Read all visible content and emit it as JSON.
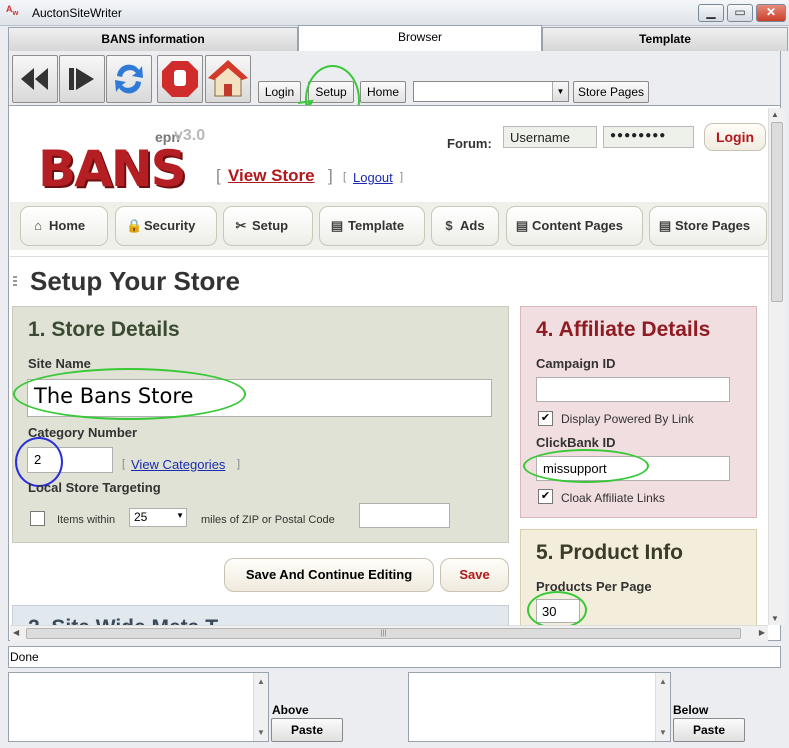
{
  "window": {
    "title": "AuctonSiteWriter",
    "minimize": "▁",
    "maximize": "▭",
    "close": "✕"
  },
  "tabs": [
    "BANS information",
    "Browser",
    "Template"
  ],
  "toolbar": {
    "login": "Login",
    "setup": "Setup",
    "home": "Home",
    "address_value": "",
    "store_pages": "Store Pages"
  },
  "site": {
    "logo": "BANS",
    "logo_epn": "epn",
    "logo_version": "v3.0",
    "view_store_open": "[",
    "view_store": "View Store",
    "view_store_close": "]",
    "logout": "Logout",
    "logout_open": "[",
    "logout_close": "]",
    "forum_label": "Forum:",
    "username_value": "Username",
    "password_value": "●●●●●●●●",
    "login_button": "Login"
  },
  "nav": [
    {
      "label": "Home",
      "icon": "⌂"
    },
    {
      "label": "Security",
      "icon": "🔒"
    },
    {
      "label": "Setup",
      "icon": "✂"
    },
    {
      "label": "Template",
      "icon": "▤"
    },
    {
      "label": "Ads",
      "icon": "$"
    },
    {
      "label": "Content Pages",
      "icon": "▤"
    },
    {
      "label": "Store Pages",
      "icon": "▤"
    }
  ],
  "page_title": "Setup Your Store",
  "store_details": {
    "heading": "1. Store Details",
    "site_name_label": "Site Name",
    "site_name_value": "The Bans Store",
    "category_label": "Category Number",
    "category_value": "2",
    "view_categories_open": "[",
    "view_categories": "View Categories",
    "view_categories_close": "]",
    "local_targeting_label": "Local Store Targeting",
    "items_within": "Items within",
    "miles_value": "25",
    "miles_of_zip": "miles of ZIP or Postal Code",
    "zip_value": ""
  },
  "actions": {
    "save_continue": "Save And Continue Editing",
    "save": "Save"
  },
  "section2_heading": "2. Site Wide Meta T",
  "affiliate": {
    "heading": "4. Affiliate Details",
    "campaign_label": "Campaign ID",
    "campaign_value": "",
    "display_powered": "Display Powered By Link",
    "clickbank_label": "ClickBank ID",
    "clickbank_value": "missupport",
    "cloak_links": "Cloak Affiliate Links"
  },
  "product_info": {
    "heading": "5. Product Info",
    "per_page_label": "Products Per Page",
    "per_page_value": "30"
  },
  "status": "Done",
  "bottom": {
    "above_label": "Above",
    "below_label": "Below",
    "paste": "Paste"
  },
  "colors": {
    "accent_red": "#b1171b",
    "annotation_green": "#38c838",
    "annotation_blue": "#2a2fd8"
  }
}
